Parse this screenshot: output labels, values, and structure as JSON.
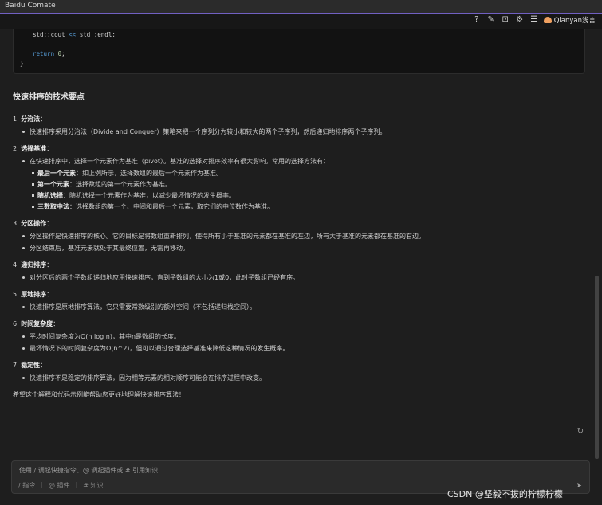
{
  "window": {
    "title": "Baidu Comate"
  },
  "topbar": {
    "icons": [
      "help-icon",
      "chat-history-icon",
      "plugin-icon",
      "gear-icon",
      "list-icon"
    ],
    "user_name": "Qianyan浅言"
  },
  "code": {
    "lines": [
      "std::cout << std::endl;",
      "return 0;",
      "}"
    ]
  },
  "answer": {
    "heading": "快速排序的技术要点",
    "sections": [
      {
        "title": "分治法",
        "bullets": [
          "快速排序采用分治法（Divide and Conquer）策略来把一个序列分为较小和较大的两个子序列，然后递归地排序两个子序列。"
        ]
      },
      {
        "title": "选择基准",
        "bullets": [
          "在快速排序中，选择一个元素作为基准（pivot）。基准的选择对排序效率有很大影响。常用的选择方法有："
        ],
        "subitems": [
          {
            "term": "最后一个元素",
            "desc": "：如上例所示，选择数组的最后一个元素作为基准。"
          },
          {
            "term": "第一个元素",
            "desc": "：选择数组的第一个元素作为基准。"
          },
          {
            "term": "随机选择",
            "desc": "：随机选择一个元素作为基准，以减少最坏情况的发生概率。"
          },
          {
            "term": "三数取中法",
            "desc": "：选择数组的第一个、中间和最后一个元素，取它们的中位数作为基准。"
          }
        ]
      },
      {
        "title": "分区操作",
        "bullets": [
          "分区操作是快速排序的核心。它的目标是将数组重新排列，使得所有小于基准的元素都在基准的左边，所有大于基准的元素都在基准的右边。",
          "分区结束后，基准元素就处于其最终位置，无需再移动。"
        ]
      },
      {
        "title": "递归排序",
        "bullets": [
          "对分区后的两个子数组递归地应用快速排序，直到子数组的大小为1或0，此时子数组已经有序。"
        ]
      },
      {
        "title": "原地排序",
        "bullets": [
          "快速排序是原地排序算法，它只需要常数级别的额外空间（不包括递归栈空间）。"
        ]
      },
      {
        "title": "时间复杂度",
        "bullets": [
          "平均时间复杂度为O(n log n)，其中n是数组的长度。",
          "最坏情况下的时间复杂度为O(n^2)，但可以通过合理选择基准来降低这种情况的发生概率。"
        ]
      },
      {
        "title": "稳定性",
        "bullets": [
          "快速排序不是稳定的排序算法，因为相等元素的相对顺序可能会在排序过程中改变。"
        ]
      }
    ],
    "closing": "希望这个解释和代码示例能帮助您更好地理解快速排序算法！"
  },
  "input": {
    "placeholder": "使用 / 调起快捷指令、@ 调起插件或 # 引用知识",
    "tools": [
      "/ 指令",
      "@ 插件",
      "# 知识"
    ]
  },
  "watermark": "CSDN @坚毅不拔的柠檬柠檬"
}
